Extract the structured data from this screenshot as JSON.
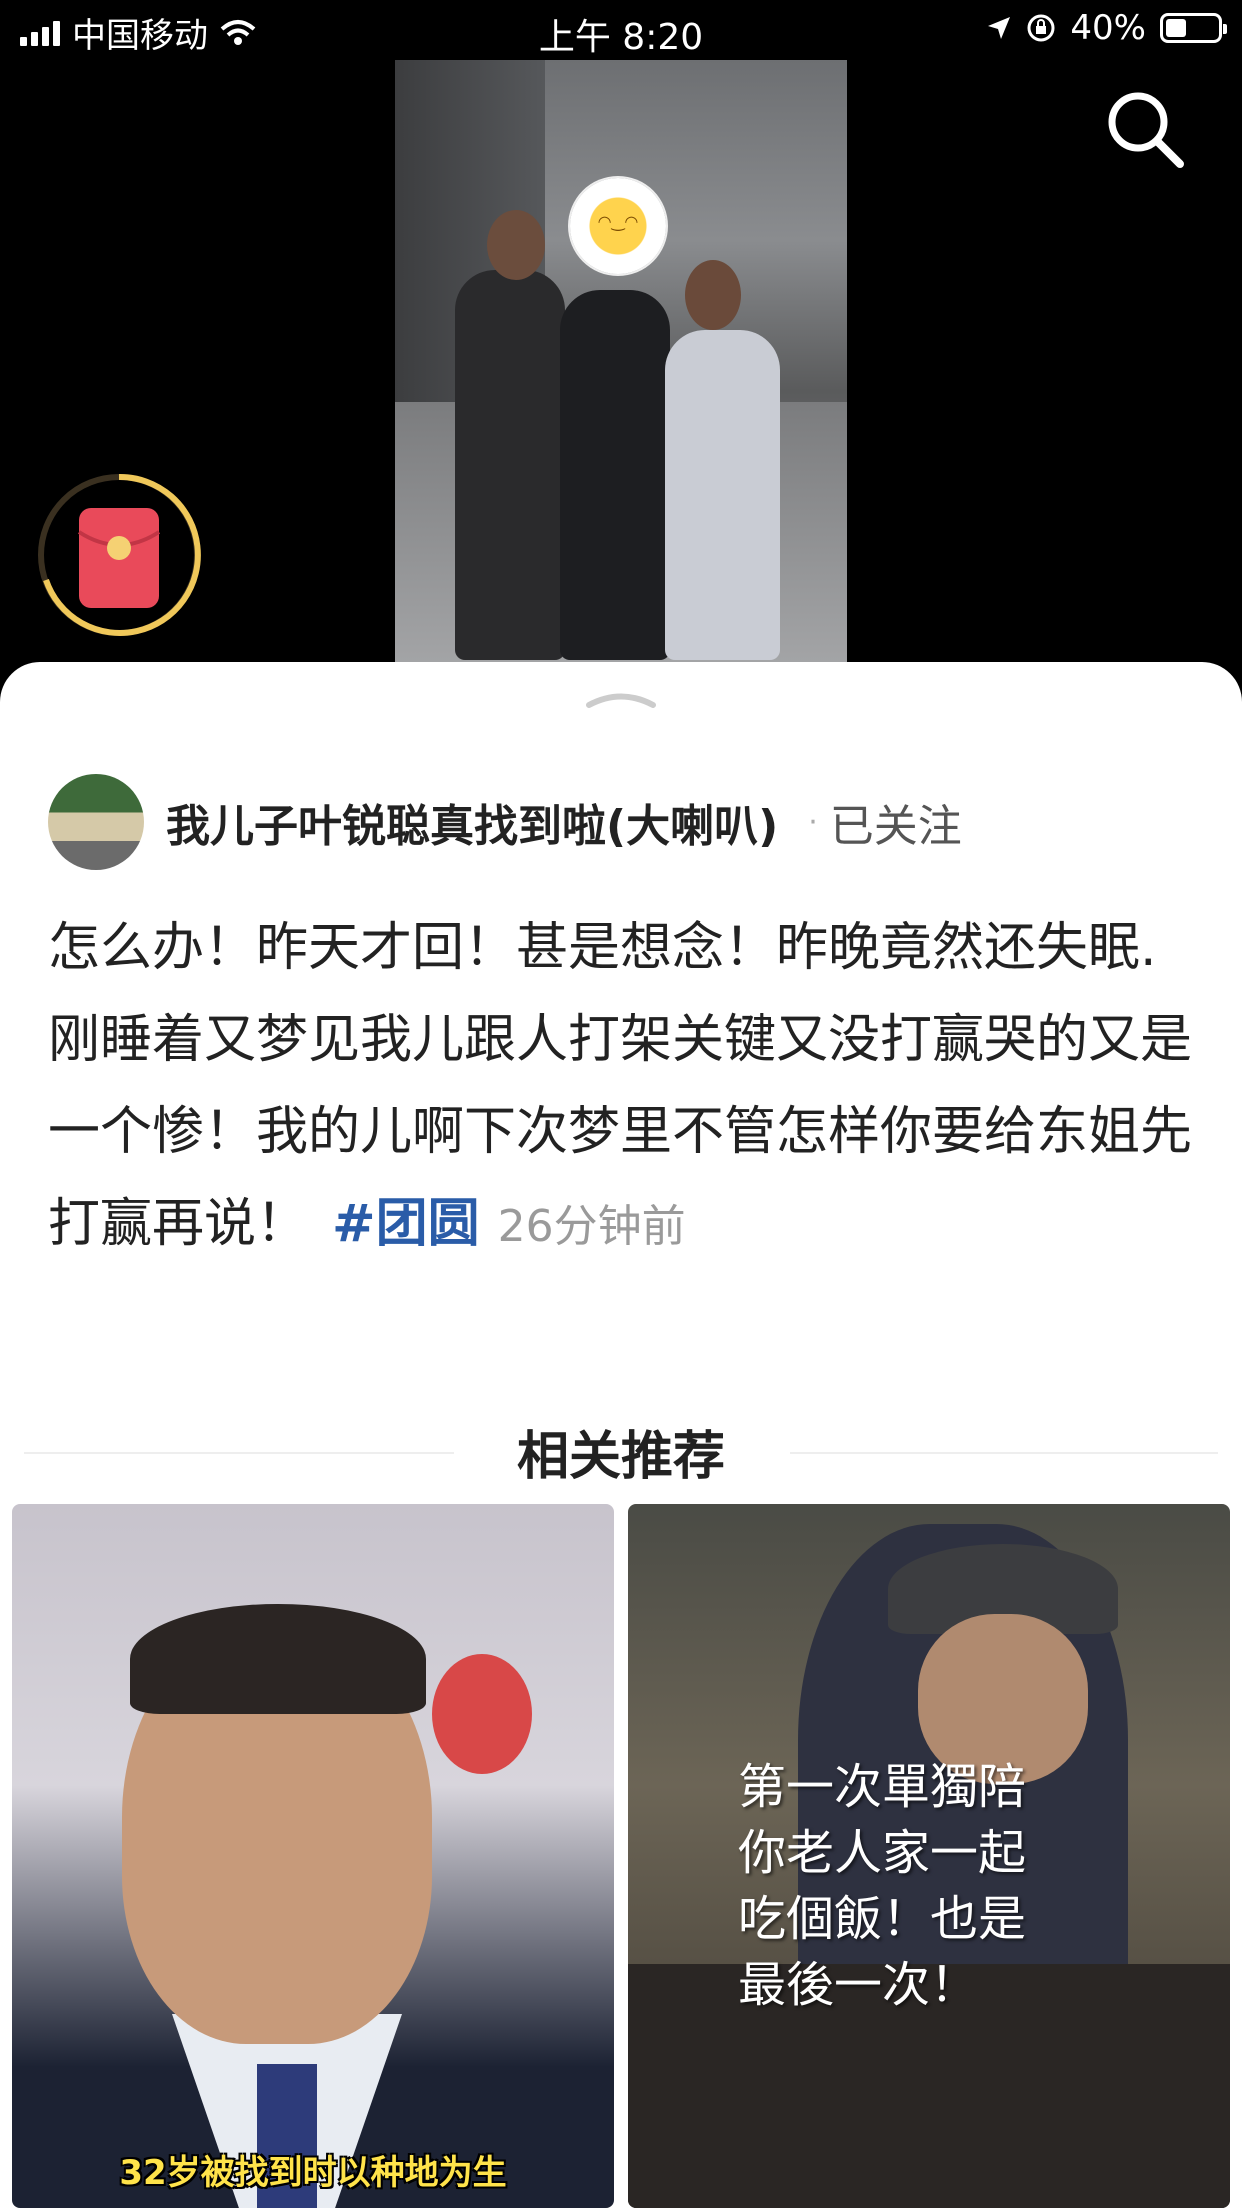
{
  "status_bar": {
    "carrier": "中国移动",
    "time": "上午 8:20",
    "battery": "40%",
    "battery_level": 0.4
  },
  "author": {
    "name": "我儿子叶锐聪真找到啦(大喇叭)",
    "separator": "·",
    "follow_status": "已关注"
  },
  "post": {
    "text": "怎么办！昨天才回！甚是想念！昨晚竟然还失眠. 刚睡着又梦见我儿跟人打架关键又没打赢哭的又是一个惨！我的儿啊下次梦里不管怎样你要给东姐先打赢再说！",
    "hashtag": "#团圆",
    "time_ago": "26分钟前"
  },
  "related": {
    "title": "相关推荐",
    "cards": [
      {
        "caption": "32岁被找到时以种地为生"
      },
      {
        "caption": "第一次單獨陪你老人家一起吃個飯！也是最後一次！"
      }
    ]
  },
  "colors": {
    "hashtag": "#2a5ca8",
    "redpacket": "#e94a5a",
    "ring": "#f0c85a"
  }
}
